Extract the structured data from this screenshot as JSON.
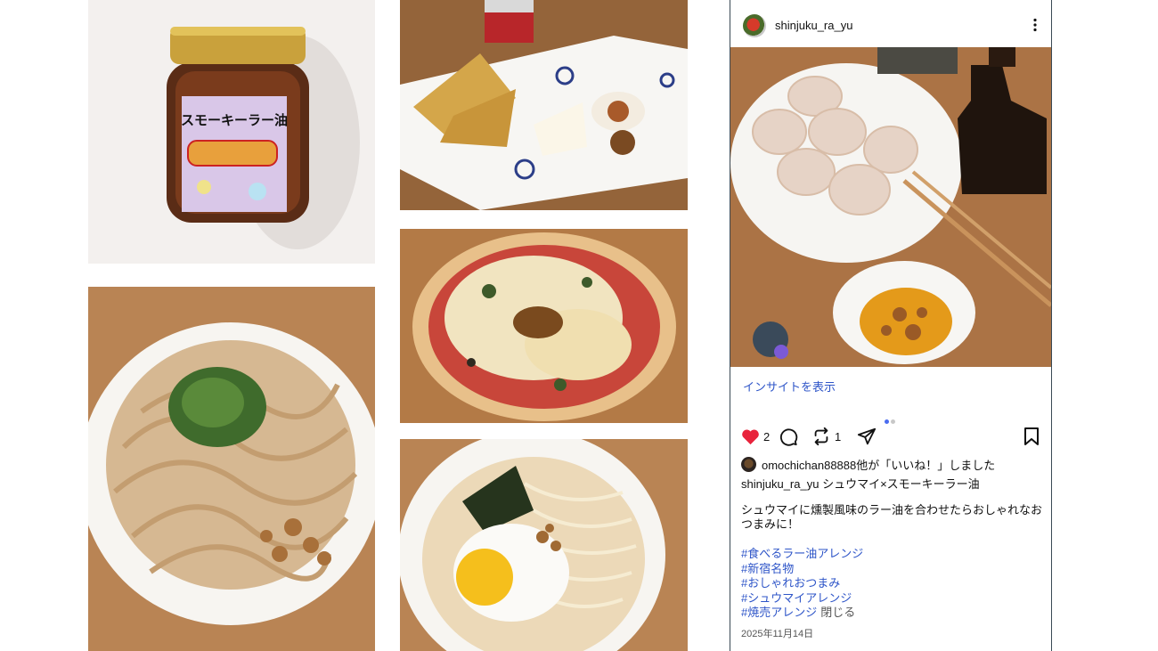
{
  "post": {
    "username": "shinjuku_ra_yu",
    "insight_link": "インサイトを表示",
    "like_count": "2",
    "repost_count": "1",
    "likes_text": "omochichan88888他が「いいね！」しました",
    "caption_author": "shinjuku_ra_yu",
    "caption_title": "シュウマイ×スモーキーラー油",
    "caption_body": "シュウマイに燻製風味のラー油を合わせたらおしゃれなおつまみに！",
    "hashtags": [
      "#食べるラー油アレンジ",
      "#新宿名物",
      "#おしゃれおつまみ",
      "#シュウマイアレンジ",
      "#焼売アレンジ"
    ],
    "close_label": "閉じる",
    "date": "2025年11月14日"
  },
  "photos": {
    "jar_label": "スモーキーラー油"
  },
  "colors": {
    "link": "#2e55c8",
    "like": "#e8243c",
    "dot_active": "#4a6cf0",
    "dot_inactive": "#c8c8c8"
  },
  "icons": [
    "more-vertical-icon",
    "heart-icon",
    "comment-icon",
    "repost-icon",
    "share-icon",
    "bookmark-icon"
  ]
}
